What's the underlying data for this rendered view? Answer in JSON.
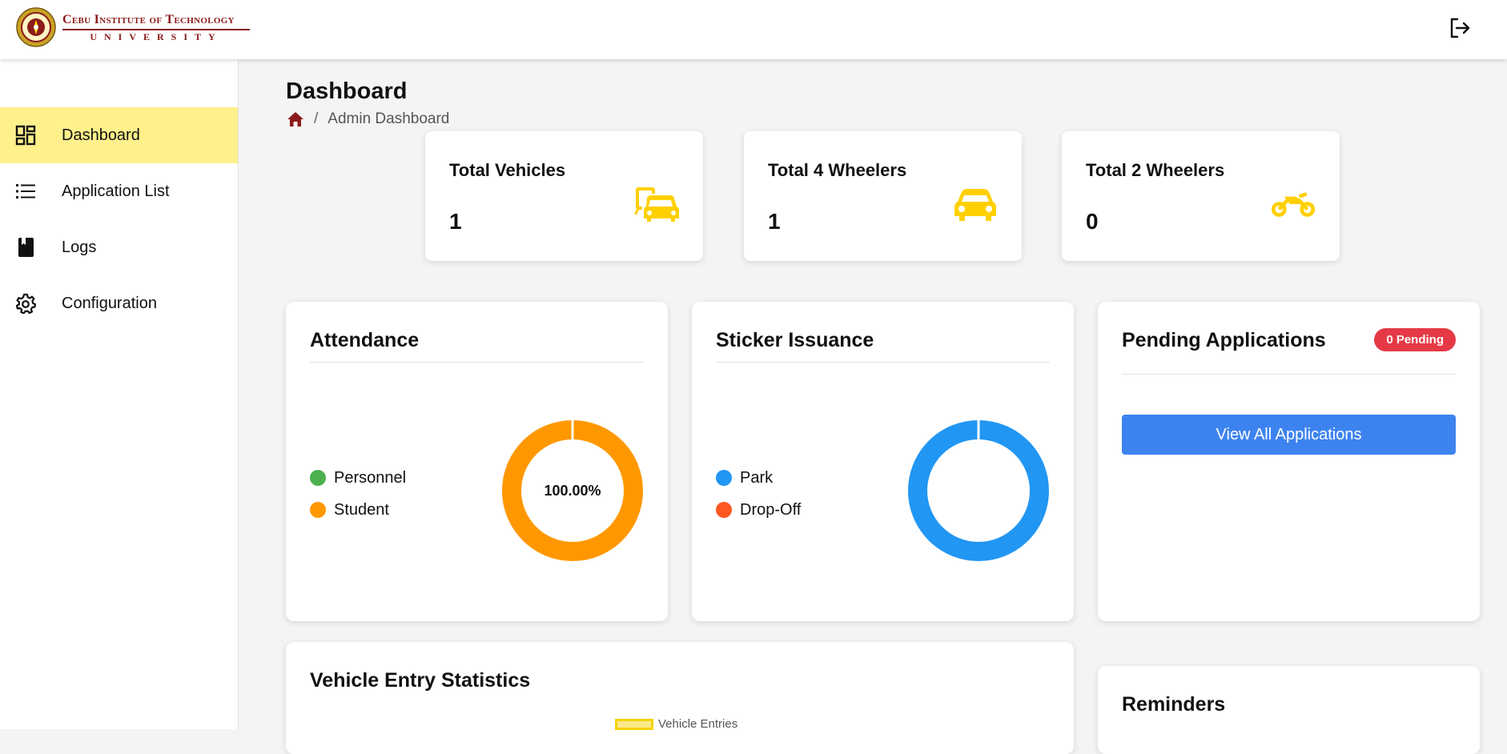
{
  "header": {
    "logo": {
      "line1": "Cebu Institute of Technology",
      "line2": "UNIVERSITY"
    },
    "logout_icon": "logout-icon"
  },
  "sidebar": {
    "items": [
      {
        "label": "Dashboard",
        "icon": "dashboard-icon",
        "active": true
      },
      {
        "label": "Application List",
        "icon": "list-icon",
        "active": false
      },
      {
        "label": "Logs",
        "icon": "book-icon",
        "active": false
      },
      {
        "label": "Configuration",
        "icon": "gear-icon",
        "active": false
      }
    ]
  },
  "page": {
    "title": "Dashboard",
    "breadcrumb": {
      "separator": "/",
      "current": "Admin Dashboard"
    }
  },
  "stats": [
    {
      "label": "Total Vehicles",
      "value": "1",
      "icon": "vehicles-icon"
    },
    {
      "label": "Total 4 Wheelers",
      "value": "1",
      "icon": "car-icon"
    },
    {
      "label": "Total 2 Wheelers",
      "value": "0",
      "icon": "motorcycle-icon"
    }
  ],
  "attendance": {
    "title": "Attendance",
    "legend": [
      {
        "label": "Personnel",
        "color": "#4caf50"
      },
      {
        "label": "Student",
        "color": "#ff9800"
      }
    ],
    "center_label": "100.00%"
  },
  "sticker": {
    "title": "Sticker Issuance",
    "legend": [
      {
        "label": "Park",
        "color": "#2196f3"
      },
      {
        "label": "Drop-Off",
        "color": "#ff5722"
      }
    ]
  },
  "pending": {
    "title": "Pending Applications",
    "badge": "0 Pending",
    "button": "View All Applications"
  },
  "vehicle_stats": {
    "title": "Vehicle Entry Statistics",
    "legend_label": "Vehicle Entries"
  },
  "reminders": {
    "title": "Reminders"
  },
  "colors": {
    "accent_yellow": "#ffd700",
    "sidebar_active": "#fff08c",
    "brand_maroon": "#8b1a1a",
    "button_blue": "#3d83f0",
    "badge_red": "#e53945"
  },
  "chart_data": [
    {
      "type": "pie",
      "title": "Attendance",
      "categories": [
        "Personnel",
        "Student"
      ],
      "values": [
        0,
        100
      ]
    },
    {
      "type": "pie",
      "title": "Sticker Issuance",
      "categories": [
        "Park",
        "Drop-Off"
      ],
      "values": [
        100,
        0
      ]
    }
  ]
}
